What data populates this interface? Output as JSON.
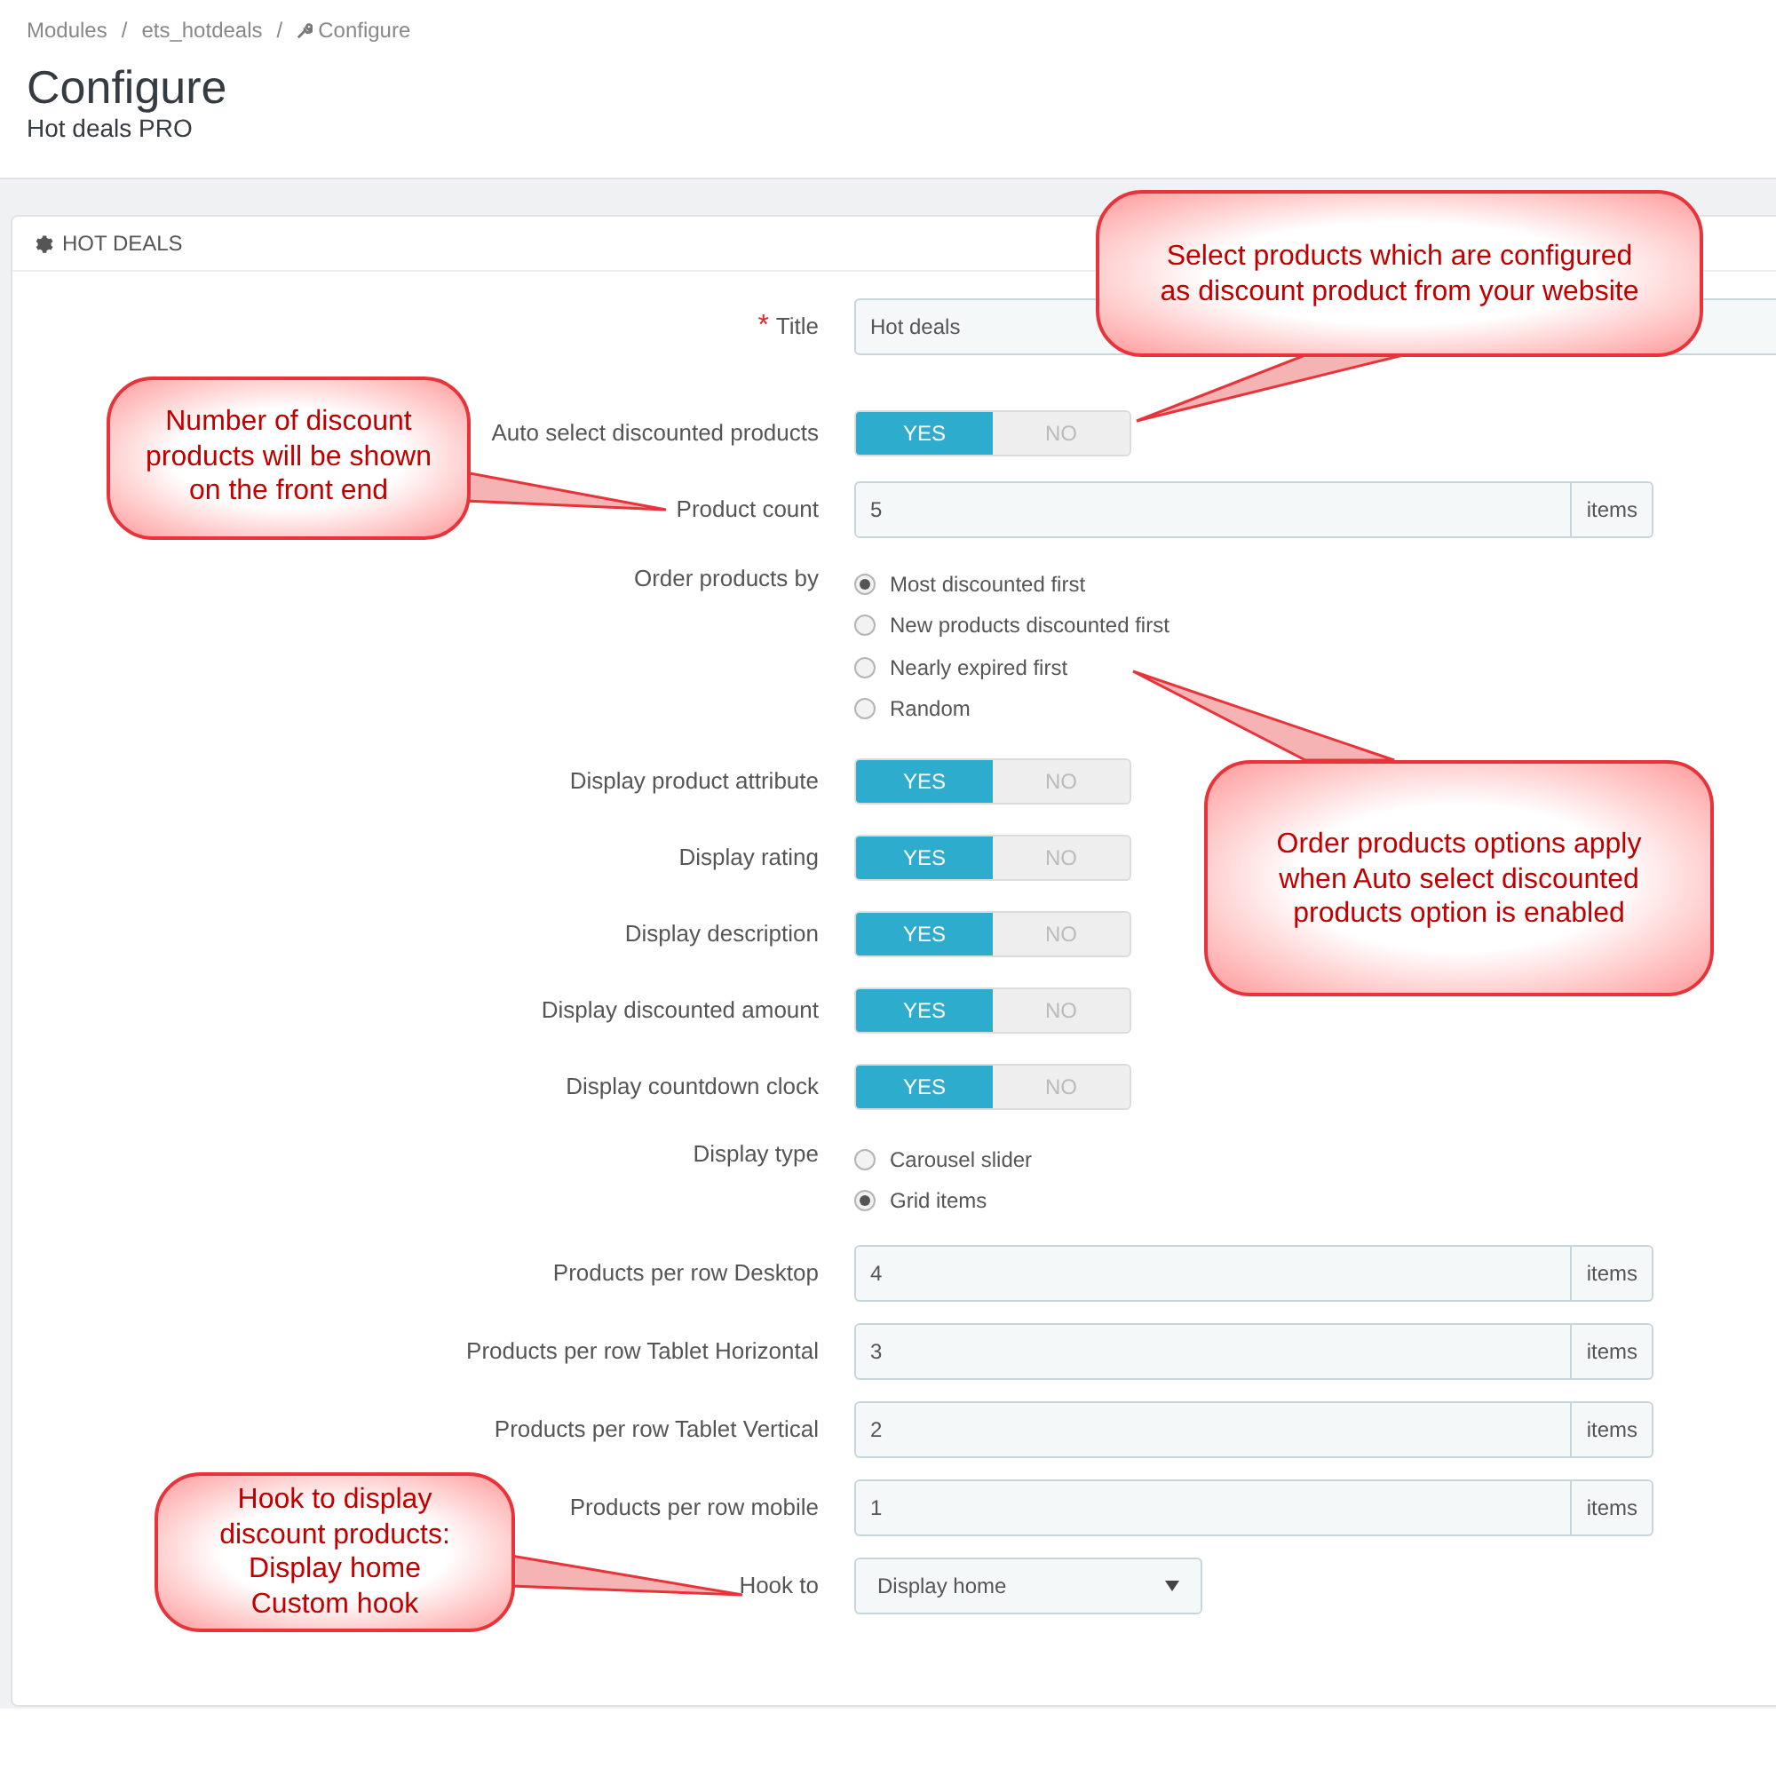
{
  "breadcrumb": [
    {
      "label": "Modules",
      "separator": "/"
    },
    {
      "label": "ets_hotdeals",
      "separator": "/"
    },
    {
      "label": "Configure"
    }
  ],
  "page_title": "Configure",
  "page_subtitle": "Hot deals PRO",
  "panel": {
    "title": "HOT DEALS"
  },
  "fields": [
    {
      "kind": "text",
      "label": "Title",
      "required_mark": "*",
      "value": "Hot deals"
    },
    {
      "kind": "switch",
      "label": "Auto select discounted products",
      "on": true,
      "yes": "YES",
      "no": "NO"
    },
    {
      "kind": "text",
      "label": "Product count",
      "value": "5",
      "suffix": "items"
    },
    {
      "kind": "radio",
      "label": "Order products by",
      "options": [
        {
          "label": "Most discounted first",
          "selected": true
        },
        {
          "label": "New products discounted first",
          "selected": false
        },
        {
          "label": "Nearly expired first",
          "selected": false
        },
        {
          "label": "Random",
          "selected": false
        }
      ]
    },
    {
      "kind": "switch",
      "label": "Display product attribute",
      "on": true,
      "yes": "YES",
      "no": "NO"
    },
    {
      "kind": "switch",
      "label": "Display rating",
      "on": true,
      "yes": "YES",
      "no": "NO"
    },
    {
      "kind": "switch",
      "label": "Display description",
      "on": true,
      "yes": "YES",
      "no": "NO"
    },
    {
      "kind": "switch",
      "label": "Display discounted amount",
      "on": true,
      "yes": "YES",
      "no": "NO"
    },
    {
      "kind": "switch",
      "label": "Display countdown clock",
      "on": true,
      "yes": "YES",
      "no": "NO"
    },
    {
      "kind": "radio",
      "label": "Display type",
      "options": [
        {
          "label": "Carousel slider",
          "selected": false
        },
        {
          "label": "Grid items",
          "selected": true
        }
      ]
    },
    {
      "kind": "text",
      "label": "Products per row Desktop",
      "value": "4",
      "suffix": "items"
    },
    {
      "kind": "text",
      "label": "Products per row Tablet Horizontal",
      "value": "3",
      "suffix": "items"
    },
    {
      "kind": "text",
      "label": "Products per row Tablet Vertical",
      "value": "2",
      "suffix": "items"
    },
    {
      "kind": "text",
      "label": "Products per row mobile",
      "value": "1",
      "suffix": "items"
    },
    {
      "kind": "select",
      "label": "Hook to",
      "value": "Display home"
    }
  ],
  "callouts": [
    {
      "lines": [
        "Select products which are configured",
        "as discount product from your website"
      ]
    },
    {
      "lines": [
        "Number of discount",
        "products will be shown",
        "on the front end"
      ]
    },
    {
      "lines": [
        "Order products options apply",
        "when Auto select discounted",
        "products option is enabled"
      ]
    },
    {
      "lines": [
        "Hook to display",
        "discount products:",
        "Display home",
        "Custom hook"
      ]
    }
  ]
}
